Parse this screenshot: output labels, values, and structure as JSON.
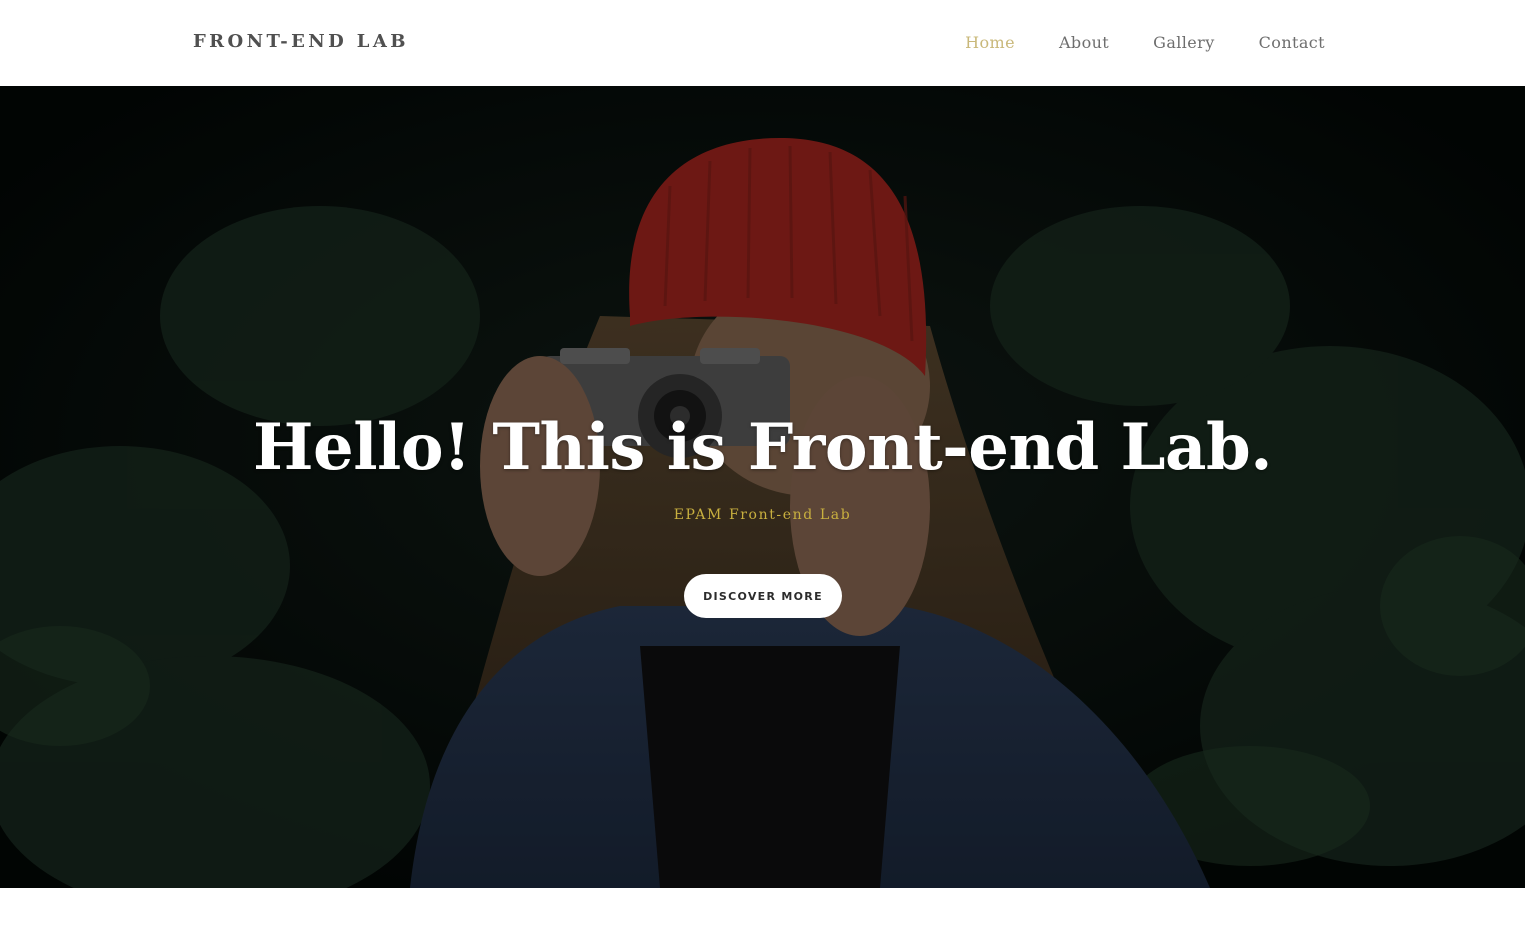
{
  "header": {
    "brand": "FRONT-END LAB",
    "nav": [
      {
        "label": "Home",
        "active": true
      },
      {
        "label": "About",
        "active": false
      },
      {
        "label": "Gallery",
        "active": false
      },
      {
        "label": "Contact",
        "active": false
      }
    ]
  },
  "hero": {
    "title": "Hello! This is Front-end Lab.",
    "subtitle": "EPAM Front-end Lab",
    "button_label": "DISCOVER MORE",
    "image": "photo-woman-red-beanie-with-camera"
  },
  "colors": {
    "accent": "#c9b87a",
    "subtitle": "#c9b03f",
    "nav_text": "#6e6e6e",
    "brand_text": "#505050",
    "beanie_red": "#a8261f"
  }
}
